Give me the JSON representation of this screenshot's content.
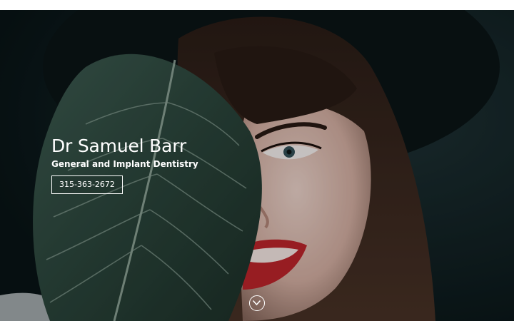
{
  "hero": {
    "title": "Dr Samuel Barr",
    "subtitle": "General and Implant Dentistry",
    "phone": "315-363-2672",
    "scroll_icon": "chevron-down-circle-icon"
  },
  "colors": {
    "page_background": "#ffffff",
    "hero_text": "#ffffff",
    "hero_dark_teal": "#0d1d1f",
    "leaf_green": "#2e4a40",
    "lipstick_red": "#c2262c"
  }
}
